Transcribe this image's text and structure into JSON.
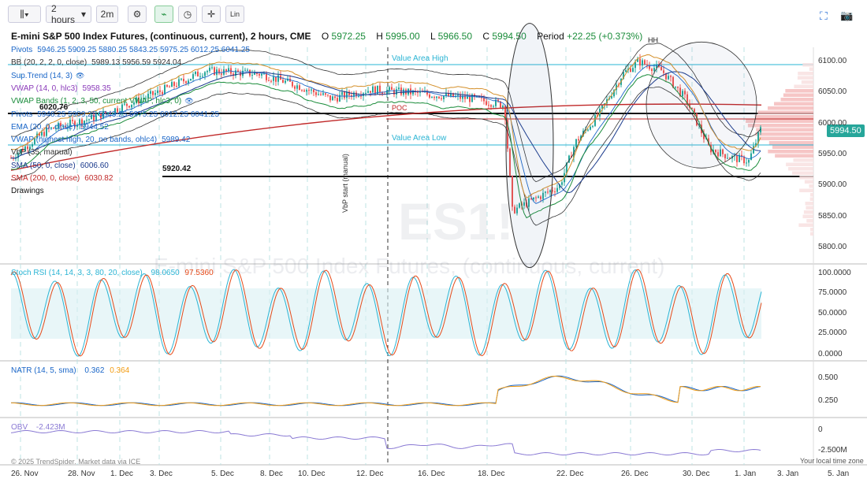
{
  "toolbar": {
    "interval": "2 hours",
    "interval_alt": "2m",
    "scale": "Lin"
  },
  "symbol": {
    "title": "E-mini S&P 500 Index Futures, (continuous, current), 2 hours, CME",
    "o_label": "O",
    "o": "5972.25",
    "h_label": "H",
    "h": "5995.00",
    "l_label": "L",
    "l": "5966.50",
    "c_label": "C",
    "c": "5994.50",
    "period_label": "Period",
    "period": "+22.25 (+0.373%)"
  },
  "legend": [
    {
      "t": "Pivots",
      "v": "5946.25 5909.25 5880.25 5843.25 5975.25 6012.25 6041.25",
      "c": "#1a66c8"
    },
    {
      "t": "BB (20, 2, 2, 0, close)",
      "v": "5989.13 5956.59 5924.04",
      "c": "#333"
    },
    {
      "t": "Sup.Trend (14, 3)",
      "v": "",
      "c": "#1a66c8"
    },
    {
      "t": "VWAP (14, 0, hlc3)",
      "v": "5958.35",
      "c": "#8a3ab9"
    },
    {
      "t": "VWAP Bands (1, 2, 3, 50, current VWAP, hlc3, 0)",
      "v": "",
      "c": "#1a8c3a"
    },
    {
      "t": "Pivots",
      "v": "5946.25 5909.25 5843.25 5975.25 6012.25 6041.25",
      "c": "#1a66c8"
    },
    {
      "t": "EMA (20, 0, close)",
      "v": "5944.52",
      "c": "#1a66c8"
    },
    {
      "t": "VWAP (highest high, 20, no bands, ohlc4)",
      "v": "5989.42",
      "c": "#1a66c8"
    },
    {
      "t": "VbP (35, manual)",
      "v": "",
      "c": "#333"
    },
    {
      "t": "SMA (50, 0, close)",
      "v": "6006.60",
      "c": "#1a3a8c"
    },
    {
      "t": "SMA (200, 0, close)",
      "v": "6030.82",
      "c": "#c02828"
    },
    {
      "t": "Drawings",
      "v": "",
      "c": "#111"
    }
  ],
  "labels": {
    "vah": "Value Area High",
    "val": "Value Area Low",
    "poc": "POC",
    "hh": "HH",
    "level1": "6020.76",
    "level2": "5920.42",
    "vbp": "VbP start (manual)",
    "price_tag": "5994.50",
    "watermark": "ES1!",
    "watermark_sub": "E-mini S&P 500 Index Futures, (continuous, current)"
  },
  "price_axis": [
    "6100.00",
    "6050.00",
    "6000.00",
    "5950.00",
    "5900.00",
    "5850.00",
    "5800.00"
  ],
  "stoch": {
    "title": "Stoch RSI (14, 14, 3, 3, 80, 20, close)",
    "k": "98.0650",
    "d": "97.5360",
    "axis": [
      "100.0000",
      "75.0000",
      "50.0000",
      "25.0000",
      "0.0000"
    ]
  },
  "natr": {
    "title": "NATR (14, 5, sma)",
    "a": "0.362",
    "b": "0.364",
    "axis": [
      "0.500",
      "0.250"
    ]
  },
  "obv": {
    "title": "OBV",
    "v": "-2.423M",
    "axis": [
      "0",
      "-2.500M"
    ]
  },
  "dates": [
    "26. Nov",
    "28. Nov",
    "1. Dec",
    "3. Dec",
    "5. Dec",
    "8. Dec",
    "10. Dec",
    "12. Dec",
    "16. Dec",
    "18. Dec",
    "22. Dec",
    "26. Dec",
    "30. Dec",
    "1. Jan",
    "3. Jan",
    "5. Jan"
  ],
  "footer": {
    "copyright": "© 2025 TrendSpider. Market data via ICE",
    "tz": "Your local time zone"
  },
  "colors": {
    "up": "#26a69a",
    "down": "#ef5350",
    "cyan": "#2ab4d4",
    "red": "#c02828"
  }
}
